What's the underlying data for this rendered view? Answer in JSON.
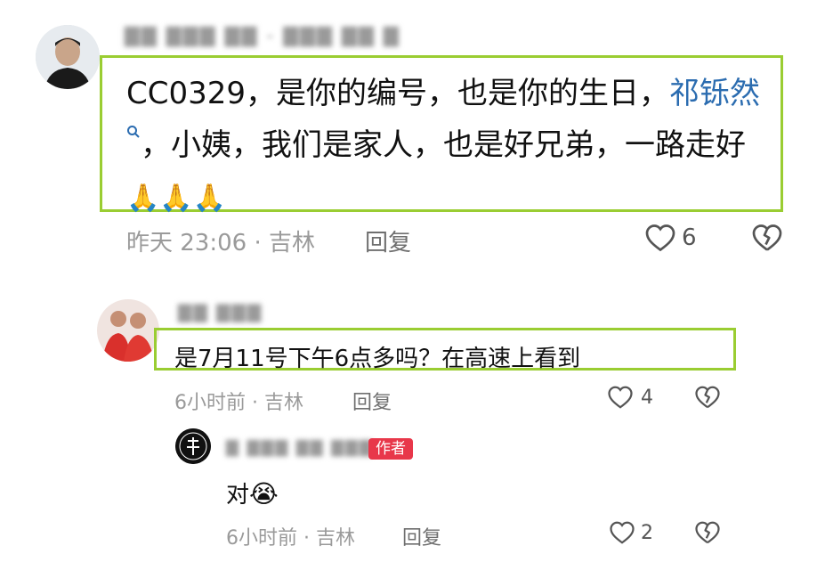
{
  "comments": [
    {
      "username": "▇▇ ▇▇▇ ▇▇ - ▇▇▇ ▇▇ ▇",
      "text_part1": "CC0329，是你的编号，也是你的生日，",
      "mention": "祁铄然",
      "text_part2": "，小姨，我们是家人，也是好兄弟，一路走好",
      "emojis": [
        "🙏",
        "🙏",
        "🙏"
      ],
      "meta": "昨天 23:06 · 吉林",
      "reply_label": "回复",
      "like_count": "6",
      "replies": [
        {
          "username": "▇▇ ▇▇▇",
          "text": "是7月11号下午6点多吗？在高速上看到",
          "meta": "6小时前 · 吉林",
          "reply_label": "回复",
          "like_count": "4"
        },
        {
          "username": "▇ ▇▇▇ ▇▇ ▇▇▇",
          "author_badge": "作者",
          "text": "对",
          "emoji": "😭",
          "meta": "6小时前 · 吉林",
          "reply_label": "回复",
          "like_count": "2"
        }
      ]
    }
  ],
  "colors": {
    "highlight_border": "#9acd32",
    "mention": "#2b6cb0",
    "author_badge": "#e8374a",
    "meta_text": "#9a9a9a"
  },
  "icons": [
    "heart-outline-icon",
    "broken-heart-icon",
    "search-icon"
  ]
}
